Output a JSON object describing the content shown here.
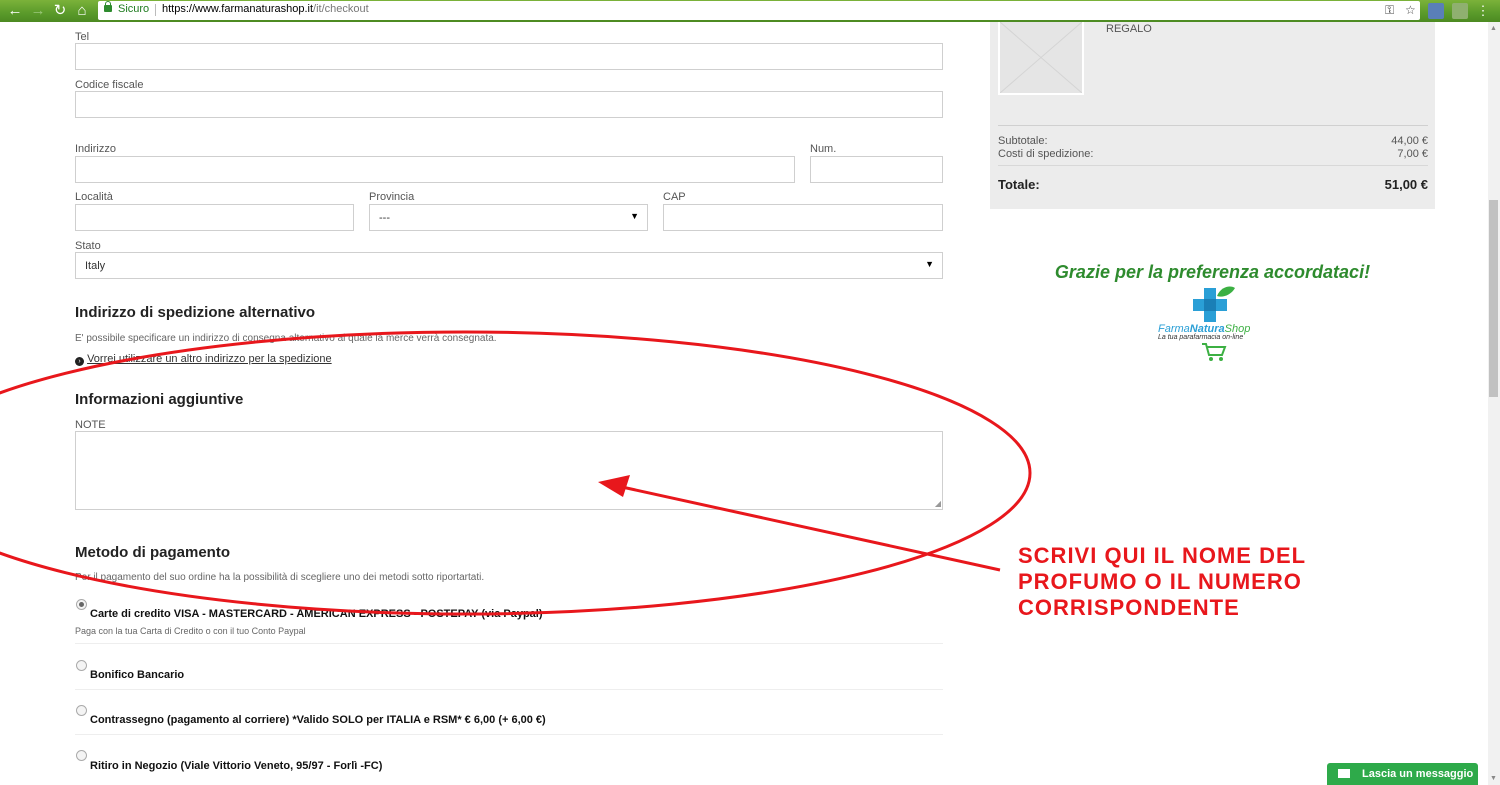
{
  "browser": {
    "security_label": "Sicuro",
    "url_domain": "https://www.farmanaturashop.it",
    "url_path": "/it/checkout"
  },
  "form": {
    "tel_label": "Tel",
    "codice_fiscale_label": "Codice fiscale",
    "indirizzo_label": "Indirizzo",
    "num_label": "Num.",
    "localita_label": "Località",
    "provincia_label": "Provincia",
    "provincia_value": "---",
    "cap_label": "CAP",
    "stato_label": "Stato",
    "stato_value": "Italy"
  },
  "alt_shipping": {
    "heading": "Indirizzo di spedizione alternativo",
    "description": "E' possibile specificare un indirizzo di consegna alternativo al quale la merce verrà consegnata.",
    "link": "Vorrei utilizzare un altro indirizzo per la spedizione"
  },
  "extra_info": {
    "heading": "Informazioni aggiuntive",
    "notes_label": "NOTE"
  },
  "payment": {
    "heading": "Metodo di pagamento",
    "description": "Per il pagamento del suo ordine ha la possibilità di scegliere uno dei metodi sotto riportartati.",
    "methods": [
      {
        "label": "Carte di credito VISA - MASTERCARD - AMERICAN EXPRESS - POSTEPAY (via Paypal)",
        "sub": "Paga con la tua Carta di Credito o con il tuo Conto Paypal",
        "selected": true
      },
      {
        "label": "Bonifico Bancario",
        "sub": "",
        "selected": false
      },
      {
        "label": "Contrassegno (pagamento al corriere) *Valido SOLO per ITALIA e RSM* € 6,00 (+ 6,00 €)",
        "sub": "",
        "selected": false
      },
      {
        "label": "Ritiro in Negozio (Viale Vittorio Veneto, 95/97 - Forlì -FC)",
        "sub": "",
        "selected": false
      }
    ]
  },
  "summary": {
    "item_name": "REGALO",
    "subtotal_label": "Subtotale:",
    "subtotal_value": "44,00 €",
    "shipping_label": "Costi di spedizione:",
    "shipping_value": "7,00 €",
    "total_label": "Totale:",
    "total_value": "51,00 €"
  },
  "thanks": "Grazie per la preferenza accordataci!",
  "logo": {
    "brand_text_1": "Farma",
    "brand_text_2": "Natura",
    "brand_text_3": "Shop",
    "tagline": "La tua parafarmacia on-line"
  },
  "annotation": {
    "line1": "SCRIVI QUI IL NOME DEL",
    "line2": "PROFUMO O IL NUMERO",
    "line3": "CORRISPONDENTE"
  },
  "chat_button": "Lascia un messaggio",
  "colors": {
    "accent_green": "#2e8b2e",
    "annotation_red": "#e8171c",
    "chat_green": "#2eaa4a"
  }
}
